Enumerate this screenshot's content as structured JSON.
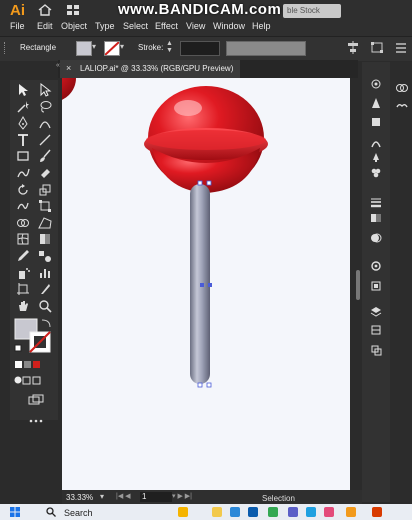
{
  "app": {
    "logo": "Ai",
    "watermark": "www.BANDICAM.com",
    "stock_search": "ble Stock"
  },
  "menu": [
    "File",
    "Edit",
    "Object",
    "Type",
    "Select",
    "Effect",
    "View",
    "Window",
    "Help"
  ],
  "control": {
    "tool_name": "Rectangle",
    "stroke_label": "Stroke:",
    "fill_color": "#c8c8d0"
  },
  "document": {
    "close": "×",
    "title": "LALIOP.ai* @ 33.33% (RGB/GPU Preview)"
  },
  "status": {
    "zoom": "33.33%",
    "page": "1",
    "mode": "Selection"
  },
  "taskbar": {
    "search": "Search"
  },
  "colors": {
    "lollipop_red": "#d8141c",
    "stick_gray": "#9fa3b8",
    "accent_orange": "#f29a1c"
  },
  "icons": [
    "home-icon",
    "grid-icon",
    "selection-tool-icon",
    "direct-selection-icon",
    "magic-wand-icon",
    "lasso-icon",
    "pen-icon",
    "curvature-icon",
    "type-icon",
    "line-icon",
    "rectangle-icon",
    "paintbrush-icon",
    "shaper-icon",
    "eraser-icon",
    "rotate-icon",
    "scale-icon",
    "warp-icon",
    "free-transform-icon",
    "shape-builder-icon",
    "perspective-icon",
    "mesh-icon",
    "gradient-icon",
    "eyedropper-icon",
    "blend-icon",
    "symbol-sprayer-icon",
    "graph-icon",
    "artboard-icon",
    "slice-icon",
    "hand-icon",
    "zoom-icon",
    "fill-stroke-icon",
    "swap-icon",
    "draw-mode-icon",
    "screen-mode-icon",
    "more-tools-icon"
  ]
}
